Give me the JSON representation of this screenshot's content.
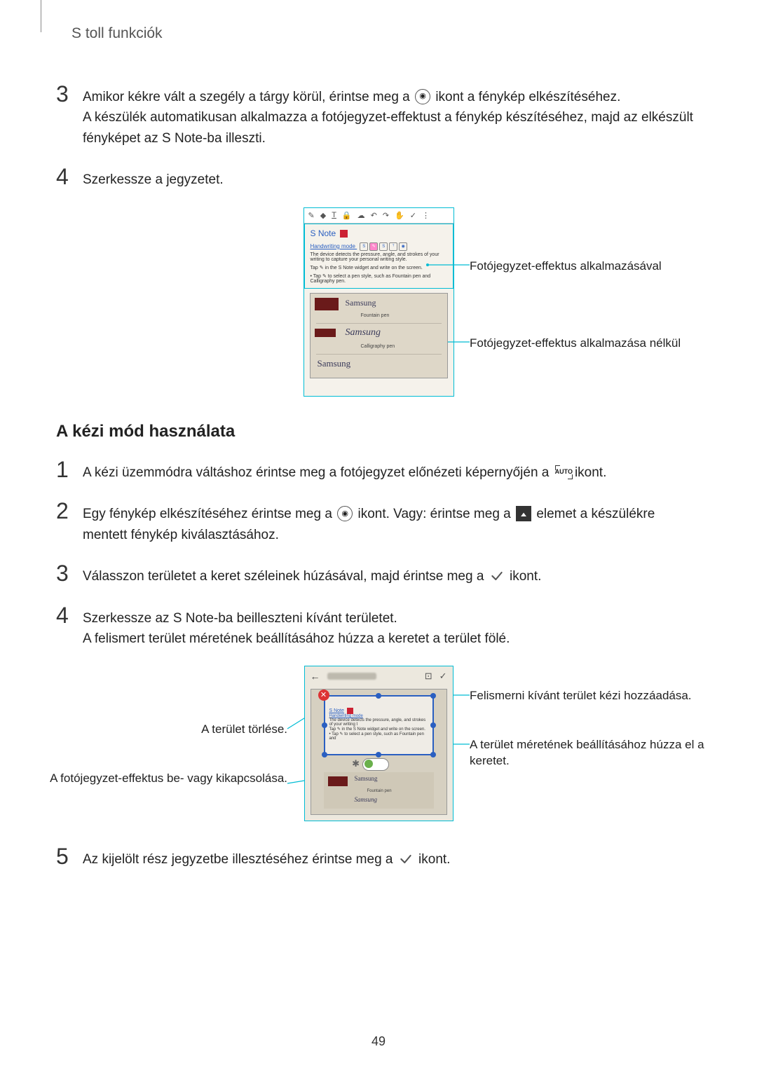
{
  "header": {
    "title": "S toll funkciók"
  },
  "stepsTop": [
    {
      "num": "3",
      "parts": {
        "a1": "Amikor kékre vált a szegély a tárgy körül, érintse meg a ",
        "a2": " ikont a fénykép elkészítéséhez.",
        "b": "A készülék automatikusan alkalmazza a fotójegyzet-effektust a fénykép készítéséhez, majd az elkészült fényképet az S Note-ba illeszti."
      }
    },
    {
      "num": "4",
      "text": "Szerkessze a jegyzetet."
    }
  ],
  "figure1": {
    "appTitle": "S Note",
    "hwMode": "Handwriting mode",
    "desc": "The device detects the pressure, angle, and strokes of your writing to capture your personal writing style.",
    "tip1": "Tap ✎ in the S Note widget and write on the screen.",
    "tip2": "• Tap ✎ to select a pen style, such as Fountain pen and Calligraphy pen.",
    "penLabels": {
      "fountain": "Fountain pen",
      "calligraphy": "Calligraphy pen"
    },
    "cursive": "Samsung",
    "callouts": {
      "c1": "Fotójegyzet-effektus alkalmazásával",
      "c2": "Fotójegyzet-effektus alkalmazása nélkül"
    }
  },
  "section2": {
    "title": "A kézi mód használata"
  },
  "stepsManual": [
    {
      "num": "1",
      "parts": {
        "a1": "A kézi üzemmódra váltáshoz érintse meg a fotójegyzet előnézeti képernyőjén a ",
        "a2": " ikont."
      },
      "autoLabel": "AUTO"
    },
    {
      "num": "2",
      "parts": {
        "a1": "Egy fénykép elkészítéséhez érintse meg a ",
        "a2": " ikont. Vagy: érintse meg a ",
        "a3": " elemet a készülékre mentett fénykép kiválasztásához."
      }
    },
    {
      "num": "3",
      "parts": {
        "a1": "Válasszon területet a keret széleinek húzásával, majd érintse meg a ",
        "a2": " ikont."
      }
    },
    {
      "num": "4",
      "text1": "Szerkessze az S Note-ba beilleszteni kívánt területet.",
      "text2": "A felismert terület méretének beállításához húzza a keretet a terület fölé."
    }
  ],
  "figure2": {
    "innerTitle": "S Note",
    "hwMode": "Handwriting mode",
    "desc": "The device detects the pressure, angle, and strokes of your writing t",
    "tip1": "Tap ✎ in the S Note widget and write on the screen.",
    "tip2": "• Tap ✎ to select a pen style, such as Fountain pen and",
    "penLabel": "Fountain pen",
    "cursive": "Samsung",
    "calloutsLeft": {
      "l1": "A terület törlése.",
      "l2": "A fotójegyzet-effektus be- vagy kikapcsolása."
    },
    "calloutsRight": {
      "r1": "Felismerni kívánt terület kézi hozzáadása.",
      "r2": "A terület méretének beállításához húzza el a keretet."
    }
  },
  "stepLast": {
    "num": "5",
    "parts": {
      "a1": "Az kijelölt rész jegyzetbe illesztéséhez érintse meg a ",
      "a2": " ikont."
    }
  },
  "pageNumber": "49"
}
